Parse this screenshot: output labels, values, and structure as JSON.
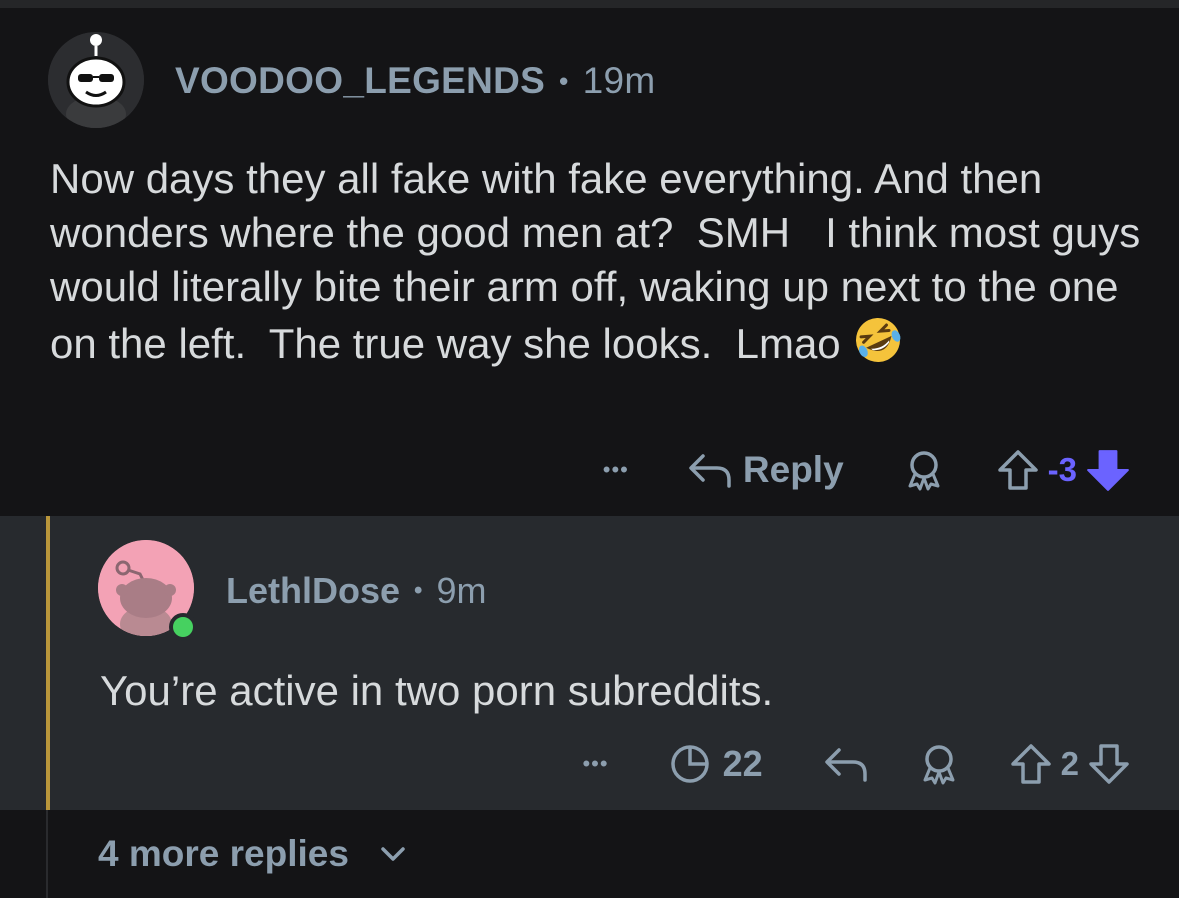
{
  "main_comment": {
    "username": "VOODOO_LEGENDS",
    "separator": "•",
    "time": "19m",
    "body": "Now days they all fake with fake everything. And then wonders where the good men at?  SMH   I think most guys would literally bite their arm off, waking up next to the one on the left.  The true way she looks.  Lmao ",
    "emoji": "rofl-emoji",
    "actions": {
      "more_label": "•••",
      "reply_label": "Reply",
      "score": "-3"
    }
  },
  "reply_comment": {
    "username": "LethlDose",
    "separator": "•",
    "time": "9m",
    "body": "You’re active in two porn subreddits.",
    "actions": {
      "more_label": "•••",
      "view_count": "22",
      "score": "2"
    }
  },
  "more_replies": {
    "label": "4 more replies"
  },
  "colors": {
    "background": "#141416",
    "reply_background": "#272a2e",
    "meta_text": "#8c9eae",
    "body_text": "#d7dadc",
    "downvote_active": "#6b63ff",
    "thread_line": "#b9963b",
    "online": "#46d160"
  }
}
